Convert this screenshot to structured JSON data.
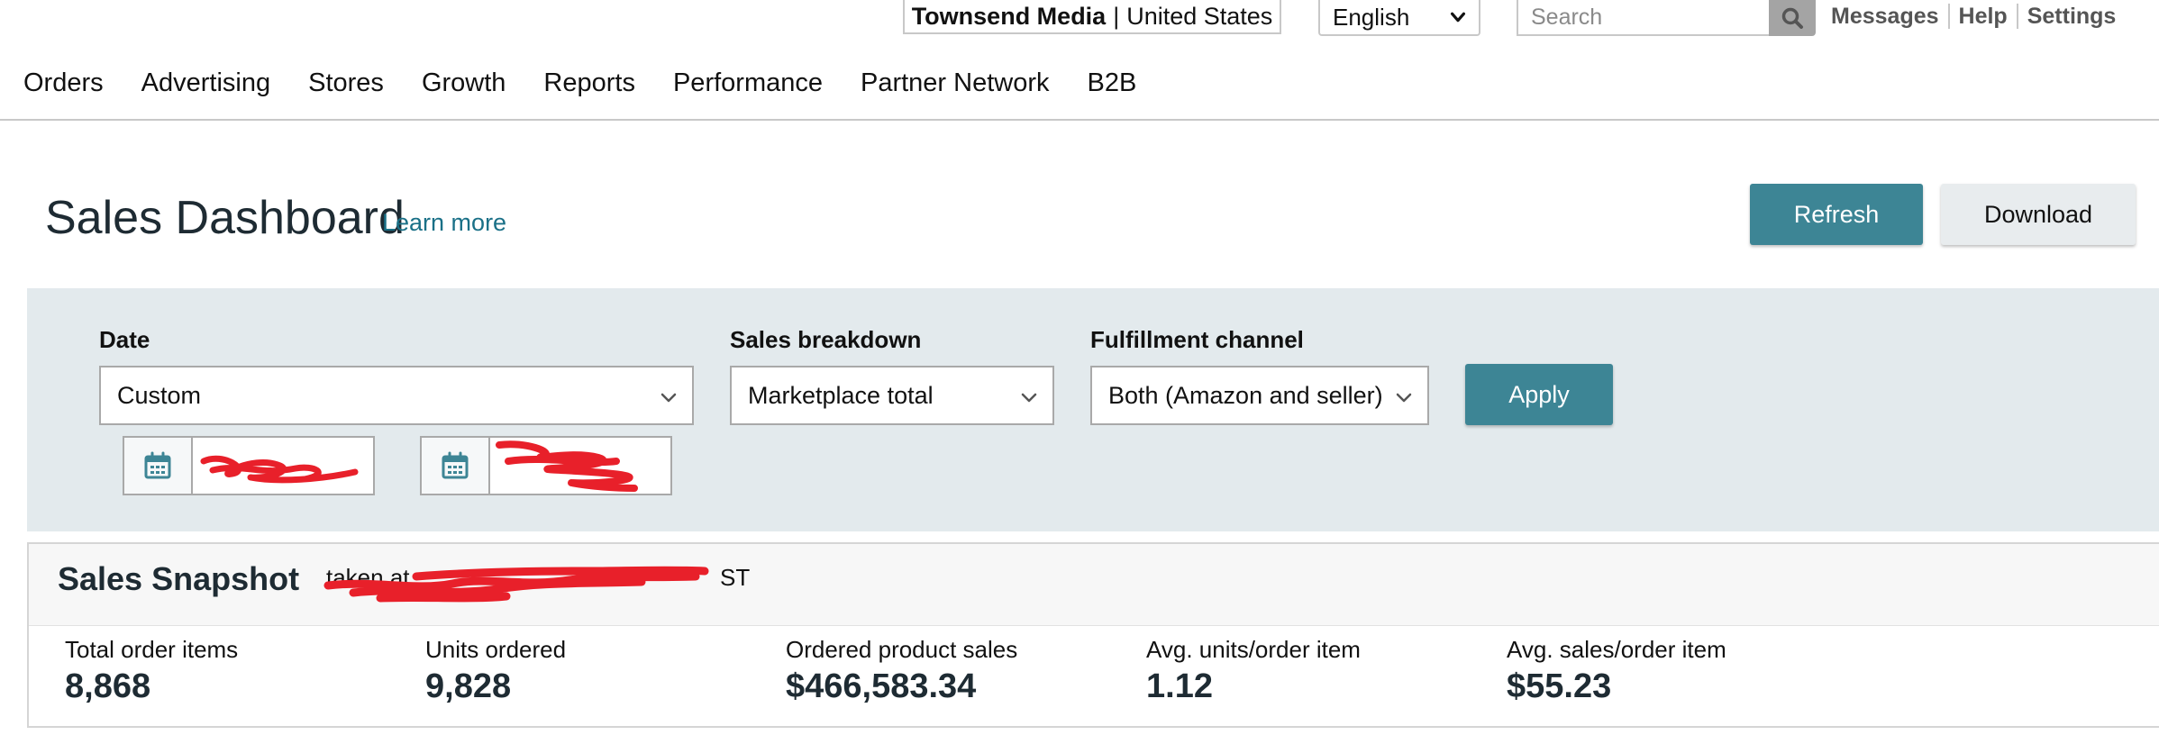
{
  "topbar": {
    "store_name": "Townsend Media",
    "separator": "|",
    "region": "United States",
    "language": "English",
    "search_placeholder": "Search",
    "links": [
      "Messages",
      "Help",
      "Settings"
    ]
  },
  "nav": {
    "items": [
      "Orders",
      "Advertising",
      "Stores",
      "Growth",
      "Reports",
      "Performance",
      "Partner Network",
      "B2B"
    ]
  },
  "header": {
    "title": "Sales Dashboard",
    "learn_more": "Learn more",
    "refresh_label": "Refresh",
    "download_label": "Download"
  },
  "filters": {
    "date_label": "Date",
    "date_value": "Custom",
    "breakdown_label": "Sales breakdown",
    "breakdown_value": "Marketplace total",
    "fulfillment_label": "Fulfillment channel",
    "fulfillment_value": "Both (Amazon and seller)",
    "apply_label": "Apply",
    "start_date": "",
    "end_date": ""
  },
  "snapshot": {
    "title": "Sales Snapshot",
    "taken_prefix": "taken at",
    "timestamp_suffix": "ST",
    "metrics": [
      {
        "label": "Total order items",
        "value": "8,868"
      },
      {
        "label": "Units ordered",
        "value": "9,828"
      },
      {
        "label": "Ordered product sales",
        "value": "$466,583.34"
      },
      {
        "label": "Avg. units/order item",
        "value": "1.12"
      },
      {
        "label": "Avg. sales/order item",
        "value": "$55.23"
      }
    ]
  },
  "colors": {
    "accent": "#3d8595",
    "panel": "#e3eaed",
    "link": "#1a7087",
    "redaction": "#e8202a"
  },
  "icons": {
    "search": "search-icon",
    "calendar": "calendar-icon",
    "dropdown": "chevron-down-icon"
  }
}
